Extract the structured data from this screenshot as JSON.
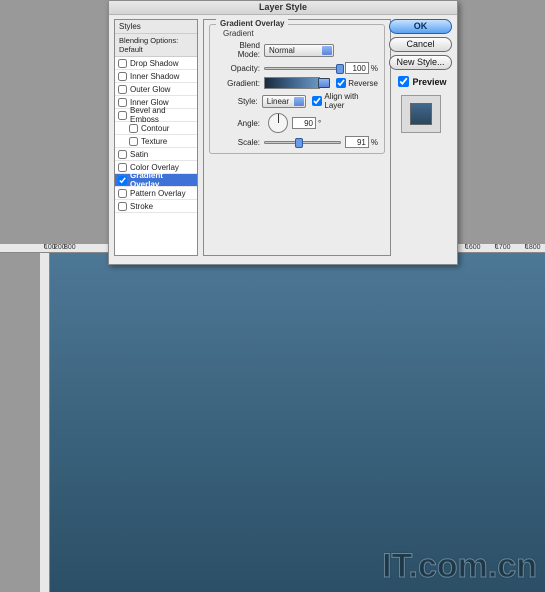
{
  "dialog": {
    "title": "Layer Style",
    "styles_header": "Styles",
    "blending_label": "Blending Options: Default",
    "styles": [
      {
        "label": "Drop Shadow",
        "checked": false,
        "indent": false
      },
      {
        "label": "Inner Shadow",
        "checked": false,
        "indent": false
      },
      {
        "label": "Outer Glow",
        "checked": false,
        "indent": false
      },
      {
        "label": "Inner Glow",
        "checked": false,
        "indent": false
      },
      {
        "label": "Bevel and Emboss",
        "checked": false,
        "indent": false
      },
      {
        "label": "Contour",
        "checked": false,
        "indent": true
      },
      {
        "label": "Texture",
        "checked": false,
        "indent": true
      },
      {
        "label": "Satin",
        "checked": false,
        "indent": false
      },
      {
        "label": "Color Overlay",
        "checked": false,
        "indent": false
      },
      {
        "label": "Gradient Overlay",
        "checked": true,
        "indent": false,
        "selected": true
      },
      {
        "label": "Pattern Overlay",
        "checked": false,
        "indent": false
      },
      {
        "label": "Stroke",
        "checked": false,
        "indent": false
      }
    ]
  },
  "settings": {
    "group_title": "Gradient Overlay",
    "sub_title": "Gradient",
    "blend_mode_label": "Blend Mode:",
    "blend_mode_value": "Normal",
    "opacity_label": "Opacity:",
    "opacity_value": "100",
    "opacity_unit": "%",
    "gradient_label": "Gradient:",
    "reverse_label": "Reverse",
    "reverse_checked": true,
    "style_label": "Style:",
    "style_value": "Linear",
    "align_label": "Align with Layer",
    "align_checked": true,
    "angle_label": "Angle:",
    "angle_value": "90",
    "angle_unit": "°",
    "scale_label": "Scale:",
    "scale_value": "91",
    "scale_unit": "%"
  },
  "buttons": {
    "ok": "OK",
    "cancel": "Cancel",
    "new_style": "New Style...",
    "preview_label": "Preview",
    "preview_checked": true
  },
  "ruler": {
    "ticks": [
      "100",
      "200",
      "300",
      "1600",
      "1700",
      "1800"
    ]
  },
  "watermark": "IT.com.cn"
}
